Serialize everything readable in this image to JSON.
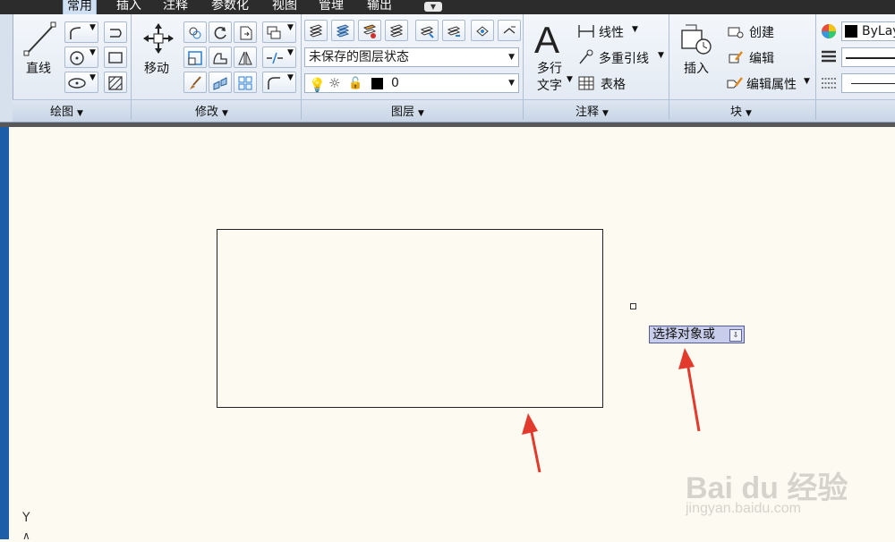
{
  "tabs": [
    "常用",
    "插入",
    "注释",
    "参数化",
    "视图",
    "管理",
    "输出"
  ],
  "panels": {
    "draw": {
      "title": "绘图",
      "line_label": "直线"
    },
    "modify": {
      "title": "修改",
      "move_label": "移动"
    },
    "layers": {
      "title": "图层",
      "state_combo": "未保存的图层状态",
      "layer_combo": "0"
    },
    "annotation": {
      "title": "注释",
      "mtext_label_1": "多行",
      "mtext_label_2": "文字",
      "linear_label": "线性",
      "mleader_label": "多重引线",
      "table_label": "表格"
    },
    "block": {
      "title": "块",
      "insert_label": "插入",
      "create_label": "创建",
      "edit_label": "编辑",
      "edit_attr_label": "编辑属性"
    },
    "properties": {
      "color_combo": "ByLay"
    }
  },
  "canvas": {
    "tooltip_text": "选择对象或",
    "ucs_label": "Y",
    "watermark_main": "Bai du 经验",
    "watermark_sub": "jingyan.baidu.com"
  },
  "colors": {
    "canvas_bg": "#fdfbf1",
    "arrow_red": "#e23b2e",
    "tooltip_bg": "#c7cdea"
  }
}
